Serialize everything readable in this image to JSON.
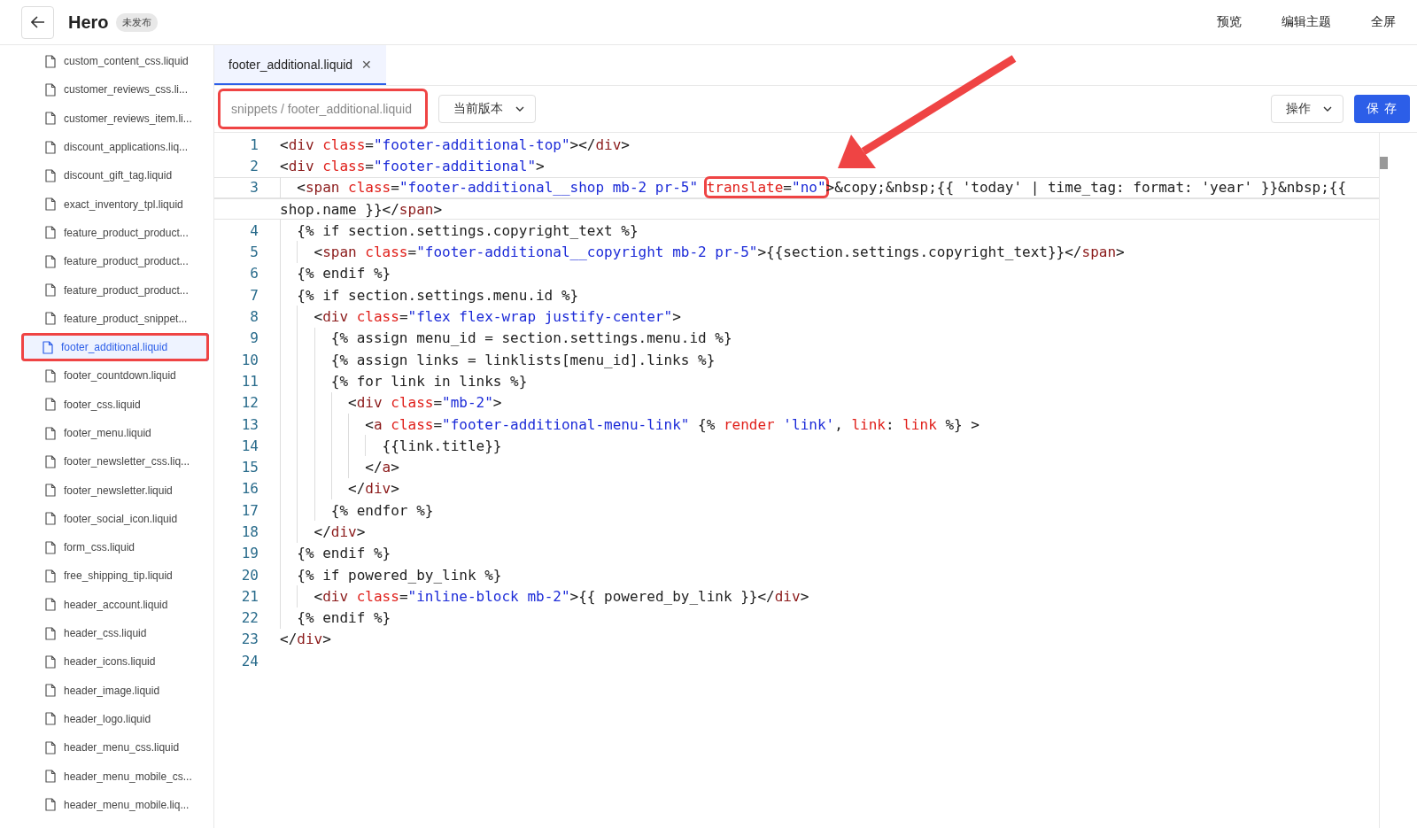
{
  "header": {
    "title": "Hero",
    "badge": "未发布",
    "actions": [
      "预览",
      "编辑主题",
      "全屏"
    ]
  },
  "sidebar": {
    "items": [
      {
        "label": "custom_content_css.liquid",
        "selected": false,
        "highlighted": false
      },
      {
        "label": "customer_reviews_css.li...",
        "selected": false,
        "highlighted": false
      },
      {
        "label": "customer_reviews_item.li...",
        "selected": false,
        "highlighted": false
      },
      {
        "label": "discount_applications.liq...",
        "selected": false,
        "highlighted": false
      },
      {
        "label": "discount_gift_tag.liquid",
        "selected": false,
        "highlighted": false
      },
      {
        "label": "exact_inventory_tpl.liquid",
        "selected": false,
        "highlighted": false
      },
      {
        "label": "feature_product_product...",
        "selected": false,
        "highlighted": false
      },
      {
        "label": "feature_product_product...",
        "selected": false,
        "highlighted": false
      },
      {
        "label": "feature_product_product...",
        "selected": false,
        "highlighted": false
      },
      {
        "label": "feature_product_snippet...",
        "selected": false,
        "highlighted": false
      },
      {
        "label": "footer_additional.liquid",
        "selected": true,
        "highlighted": true
      },
      {
        "label": "footer_countdown.liquid",
        "selected": false,
        "highlighted": false
      },
      {
        "label": "footer_css.liquid",
        "selected": false,
        "highlighted": false
      },
      {
        "label": "footer_menu.liquid",
        "selected": false,
        "highlighted": false
      },
      {
        "label": "footer_newsletter_css.liq...",
        "selected": false,
        "highlighted": false
      },
      {
        "label": "footer_newsletter.liquid",
        "selected": false,
        "highlighted": false
      },
      {
        "label": "footer_social_icon.liquid",
        "selected": false,
        "highlighted": false
      },
      {
        "label": "form_css.liquid",
        "selected": false,
        "highlighted": false
      },
      {
        "label": "free_shipping_tip.liquid",
        "selected": false,
        "highlighted": false
      },
      {
        "label": "header_account.liquid",
        "selected": false,
        "highlighted": false
      },
      {
        "label": "header_css.liquid",
        "selected": false,
        "highlighted": false
      },
      {
        "label": "header_icons.liquid",
        "selected": false,
        "highlighted": false
      },
      {
        "label": "header_image.liquid",
        "selected": false,
        "highlighted": false
      },
      {
        "label": "header_logo.liquid",
        "selected": false,
        "highlighted": false
      },
      {
        "label": "header_menu_css.liquid",
        "selected": false,
        "highlighted": false
      },
      {
        "label": "header_menu_mobile_cs...",
        "selected": false,
        "highlighted": false
      },
      {
        "label": "header_menu_mobile.liq...",
        "selected": false,
        "highlighted": false
      }
    ]
  },
  "tabs": [
    {
      "label": "footer_additional.liquid",
      "selected": true,
      "close": "✕"
    }
  ],
  "toolbar": {
    "path": {
      "placeholder": "snippets / footer_additional.liquid",
      "highlighted": true
    },
    "version": "当前版本",
    "actions": "操作",
    "save": "保 存"
  },
  "editor": {
    "lines": [
      {
        "number": "1",
        "current": false,
        "rows": [
          {
            "tokens": [
              {
                "kind": "punct",
                "text": "<"
              },
              {
                "kind": "tag",
                "text": "div"
              },
              {
                "kind": "attr",
                "text": " class"
              },
              {
                "kind": "punct",
                "text": "="
              },
              {
                "kind": "str",
                "text": "\"footer-additional-top\""
              },
              {
                "kind": "punct",
                "text": "></"
              },
              {
                "kind": "tag",
                "text": "div"
              },
              {
                "kind": "punct",
                "text": ">"
              }
            ]
          }
        ]
      },
      {
        "number": "2",
        "current": false,
        "rows": [
          {
            "tokens": [
              {
                "kind": "punct",
                "text": "<"
              },
              {
                "kind": "tag",
                "text": "div"
              },
              {
                "kind": "attr",
                "text": " class"
              },
              {
                "kind": "punct",
                "text": "="
              },
              {
                "kind": "str",
                "text": "\"footer-additional\""
              },
              {
                "kind": "punct",
                "text": ">"
              }
            ]
          }
        ]
      },
      {
        "number": "3",
        "current": true,
        "rows": [
          {
            "tokens": [
              {
                "kind": "punct",
                "text": "  <"
              },
              {
                "kind": "tag",
                "text": "span"
              },
              {
                "kind": "attr",
                "text": " class"
              },
              {
                "kind": "punct",
                "text": "="
              },
              {
                "kind": "str",
                "text": "\"footer-additional__shop mb-2 pr-5\" "
              },
              {
                "kind": "group",
                "highlighted": true,
                "tokens": [
                  {
                    "kind": "attr",
                    "text": "translate"
                  },
                  {
                    "kind": "punct",
                    "text": "="
                  },
                  {
                    "kind": "str",
                    "text": "\"no\""
                  }
                ]
              },
              {
                "kind": "punct",
                "text": ">&copy;&nbsp;{{ 'today' | time_tag: format: 'year' }}&nbsp;{{"
              }
            ]
          },
          {
            "tokens": [
              {
                "kind": "plain",
                "text": "shop.name }}</"
              },
              {
                "kind": "tag",
                "text": "span"
              },
              {
                "kind": "punct",
                "text": ">"
              }
            ]
          }
        ]
      },
      {
        "number": "4",
        "current": false,
        "rows": [
          {
            "tokens": [
              {
                "kind": "plain",
                "text": "  {% if section.settings.copyright_text %}"
              }
            ]
          }
        ]
      },
      {
        "number": "5",
        "current": false,
        "rows": [
          {
            "tokens": [
              {
                "kind": "punct",
                "text": "    <"
              },
              {
                "kind": "tag",
                "text": "span"
              },
              {
                "kind": "attr",
                "text": " class"
              },
              {
                "kind": "punct",
                "text": "="
              },
              {
                "kind": "str",
                "text": "\"footer-additional__copyright mb-2 pr-5\""
              },
              {
                "kind": "punct",
                "text": ">{{section.settings.copyright_text}}</"
              },
              {
                "kind": "tag",
                "text": "span"
              },
              {
                "kind": "punct",
                "text": ">"
              }
            ]
          }
        ]
      },
      {
        "number": "6",
        "current": false,
        "rows": [
          {
            "tokens": [
              {
                "kind": "plain",
                "text": "  {% endif %}"
              }
            ]
          }
        ]
      },
      {
        "number": "7",
        "current": false,
        "rows": [
          {
            "tokens": [
              {
                "kind": "plain",
                "text": "  {% if section.settings.menu.id %}"
              }
            ]
          }
        ]
      },
      {
        "number": "8",
        "current": false,
        "rows": [
          {
            "tokens": [
              {
                "kind": "punct",
                "text": "    <"
              },
              {
                "kind": "tag",
                "text": "div"
              },
              {
                "kind": "attr",
                "text": " class"
              },
              {
                "kind": "punct",
                "text": "="
              },
              {
                "kind": "str",
                "text": "\"flex flex-wrap justify-center\""
              },
              {
                "kind": "punct",
                "text": ">"
              }
            ]
          }
        ]
      },
      {
        "number": "9",
        "current": false,
        "rows": [
          {
            "tokens": [
              {
                "kind": "plain",
                "text": "      {% assign menu_id = section.settings.menu.id %}"
              }
            ]
          }
        ]
      },
      {
        "number": "10",
        "current": false,
        "rows": [
          {
            "tokens": [
              {
                "kind": "plain",
                "text": "      {% assign links = linklists[menu_id].links %}"
              }
            ]
          }
        ]
      },
      {
        "number": "11",
        "current": false,
        "rows": [
          {
            "tokens": [
              {
                "kind": "plain",
                "text": "      {% for link in links %}"
              }
            ]
          }
        ]
      },
      {
        "number": "12",
        "current": false,
        "rows": [
          {
            "tokens": [
              {
                "kind": "punct",
                "text": "        <"
              },
              {
                "kind": "tag",
                "text": "div"
              },
              {
                "kind": "attr",
                "text": " class"
              },
              {
                "kind": "punct",
                "text": "="
              },
              {
                "kind": "str",
                "text": "\"mb-2\""
              },
              {
                "kind": "punct",
                "text": ">"
              }
            ]
          }
        ]
      },
      {
        "number": "13",
        "current": false,
        "rows": [
          {
            "tokens": [
              {
                "kind": "punct",
                "text": "          <"
              },
              {
                "kind": "tag",
                "text": "a"
              },
              {
                "kind": "attr",
                "text": " class"
              },
              {
                "kind": "punct",
                "text": "="
              },
              {
                "kind": "str",
                "text": "\"footer-additional-menu-link\""
              },
              {
                "kind": "plain",
                "text": " {% "
              },
              {
                "kind": "attr",
                "text": "render"
              },
              {
                "kind": "str",
                "text": " 'link'"
              },
              {
                "kind": "plain",
                "text": ", "
              },
              {
                "kind": "attr",
                "text": "link"
              },
              {
                "kind": "plain",
                "text": ": "
              },
              {
                "kind": "attr",
                "text": "link"
              },
              {
                "kind": "plain",
                "text": " %} >"
              }
            ]
          }
        ]
      },
      {
        "number": "14",
        "current": false,
        "rows": [
          {
            "tokens": [
              {
                "kind": "plain",
                "text": "            {{link.title}}"
              }
            ]
          }
        ]
      },
      {
        "number": "15",
        "current": false,
        "rows": [
          {
            "tokens": [
              {
                "kind": "punct",
                "text": "          </"
              },
              {
                "kind": "tag",
                "text": "a"
              },
              {
                "kind": "punct",
                "text": ">"
              }
            ]
          }
        ]
      },
      {
        "number": "16",
        "current": false,
        "rows": [
          {
            "tokens": [
              {
                "kind": "punct",
                "text": "        </"
              },
              {
                "kind": "tag",
                "text": "div"
              },
              {
                "kind": "punct",
                "text": ">"
              }
            ]
          }
        ]
      },
      {
        "number": "17",
        "current": false,
        "rows": [
          {
            "tokens": [
              {
                "kind": "plain",
                "text": "      {% endfor %}"
              }
            ]
          }
        ]
      },
      {
        "number": "18",
        "current": false,
        "rows": [
          {
            "tokens": [
              {
                "kind": "punct",
                "text": "    </"
              },
              {
                "kind": "tag",
                "text": "div"
              },
              {
                "kind": "punct",
                "text": ">"
              }
            ]
          }
        ]
      },
      {
        "number": "19",
        "current": false,
        "rows": [
          {
            "tokens": [
              {
                "kind": "plain",
                "text": "  {% endif %}"
              }
            ]
          }
        ]
      },
      {
        "number": "20",
        "current": false,
        "rows": [
          {
            "tokens": [
              {
                "kind": "plain",
                "text": "  {% if powered_by_link %}"
              }
            ]
          }
        ]
      },
      {
        "number": "21",
        "current": false,
        "rows": [
          {
            "tokens": [
              {
                "kind": "punct",
                "text": "    <"
              },
              {
                "kind": "tag",
                "text": "div"
              },
              {
                "kind": "attr",
                "text": " class"
              },
              {
                "kind": "punct",
                "text": "="
              },
              {
                "kind": "str",
                "text": "\"inline-block mb-2\""
              },
              {
                "kind": "punct",
                "text": ">{{ powered_by_link }}</"
              },
              {
                "kind": "tag",
                "text": "div"
              },
              {
                "kind": "punct",
                "text": ">"
              }
            ]
          }
        ]
      },
      {
        "number": "22",
        "current": false,
        "rows": [
          {
            "tokens": [
              {
                "kind": "plain",
                "text": "  {% endif %}"
              }
            ]
          }
        ]
      },
      {
        "number": "23",
        "current": false,
        "rows": [
          {
            "tokens": [
              {
                "kind": "punct",
                "text": "</"
              },
              {
                "kind": "tag",
                "text": "div"
              },
              {
                "kind": "punct",
                "text": ">"
              }
            ]
          }
        ]
      },
      {
        "number": "24",
        "current": false
      }
    ]
  },
  "annotations": [
    {
      "kind": "arrow"
    }
  ]
}
